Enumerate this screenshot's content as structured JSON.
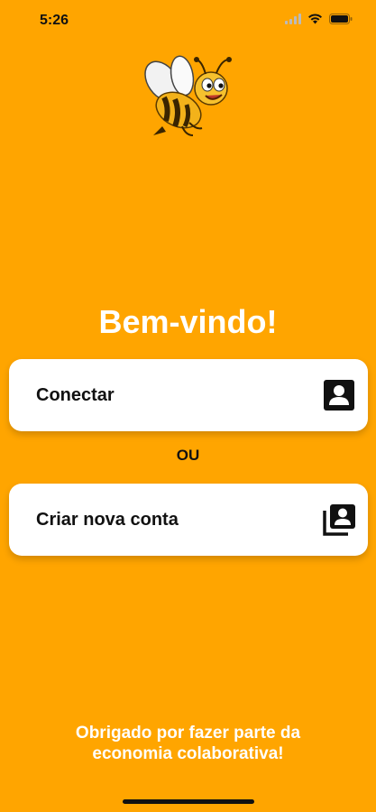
{
  "status_bar": {
    "time": "5:26"
  },
  "logo": {
    "icon": "bee-mascot-icon"
  },
  "welcome": {
    "title": "Bem-vindo!"
  },
  "actions": {
    "login_label": "Conectar",
    "login_icon": "person-badge-icon",
    "divider": "OU",
    "signup_label": "Criar nova conta",
    "signup_icon": "person-stack-icon"
  },
  "footer": {
    "message": "Obrigado por fazer parte da economia colaborativa!"
  },
  "colors": {
    "background": "#FFA500",
    "card": "#FFFFFF",
    "title_text": "#FFFFFF",
    "label_text": "#111111"
  }
}
